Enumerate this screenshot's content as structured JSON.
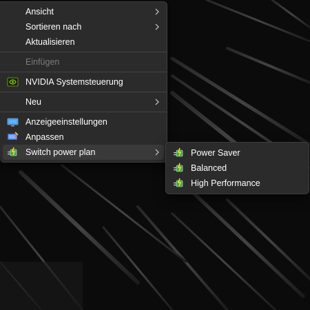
{
  "colors": {
    "menu_bg": "#2b2b2b",
    "menu_hover": "#3a3a3a",
    "separator": "#444444",
    "text": "#ffffff",
    "text_disabled": "#7b7b7b",
    "wallpaper": "#0b0b0b",
    "nvidia_green": "#76b900"
  },
  "context_menu": {
    "items": [
      {
        "label": "Ansicht",
        "has_submenu": true
      },
      {
        "label": "Sortieren nach",
        "has_submenu": true
      },
      {
        "label": "Aktualisieren"
      },
      {
        "label": "Einfügen",
        "disabled": true
      },
      {
        "label": "NVIDIA Systemsteuerung",
        "icon": "nvidia-icon"
      },
      {
        "label": "Neu",
        "has_submenu": true
      },
      {
        "label": "Anzeigeeinstellungen",
        "icon": "display-settings-icon"
      },
      {
        "label": "Anpassen",
        "icon": "personalize-icon"
      },
      {
        "label": "Switch power plan",
        "icon": "power-plan-icon",
        "has_submenu": true,
        "highlighted": true
      }
    ]
  },
  "power_plan_submenu": {
    "items": [
      {
        "label": "Power Saver",
        "icon": "power-plan-icon"
      },
      {
        "label": "Balanced",
        "icon": "power-plan-icon"
      },
      {
        "label": "High Performance",
        "icon": "power-plan-icon"
      }
    ]
  }
}
